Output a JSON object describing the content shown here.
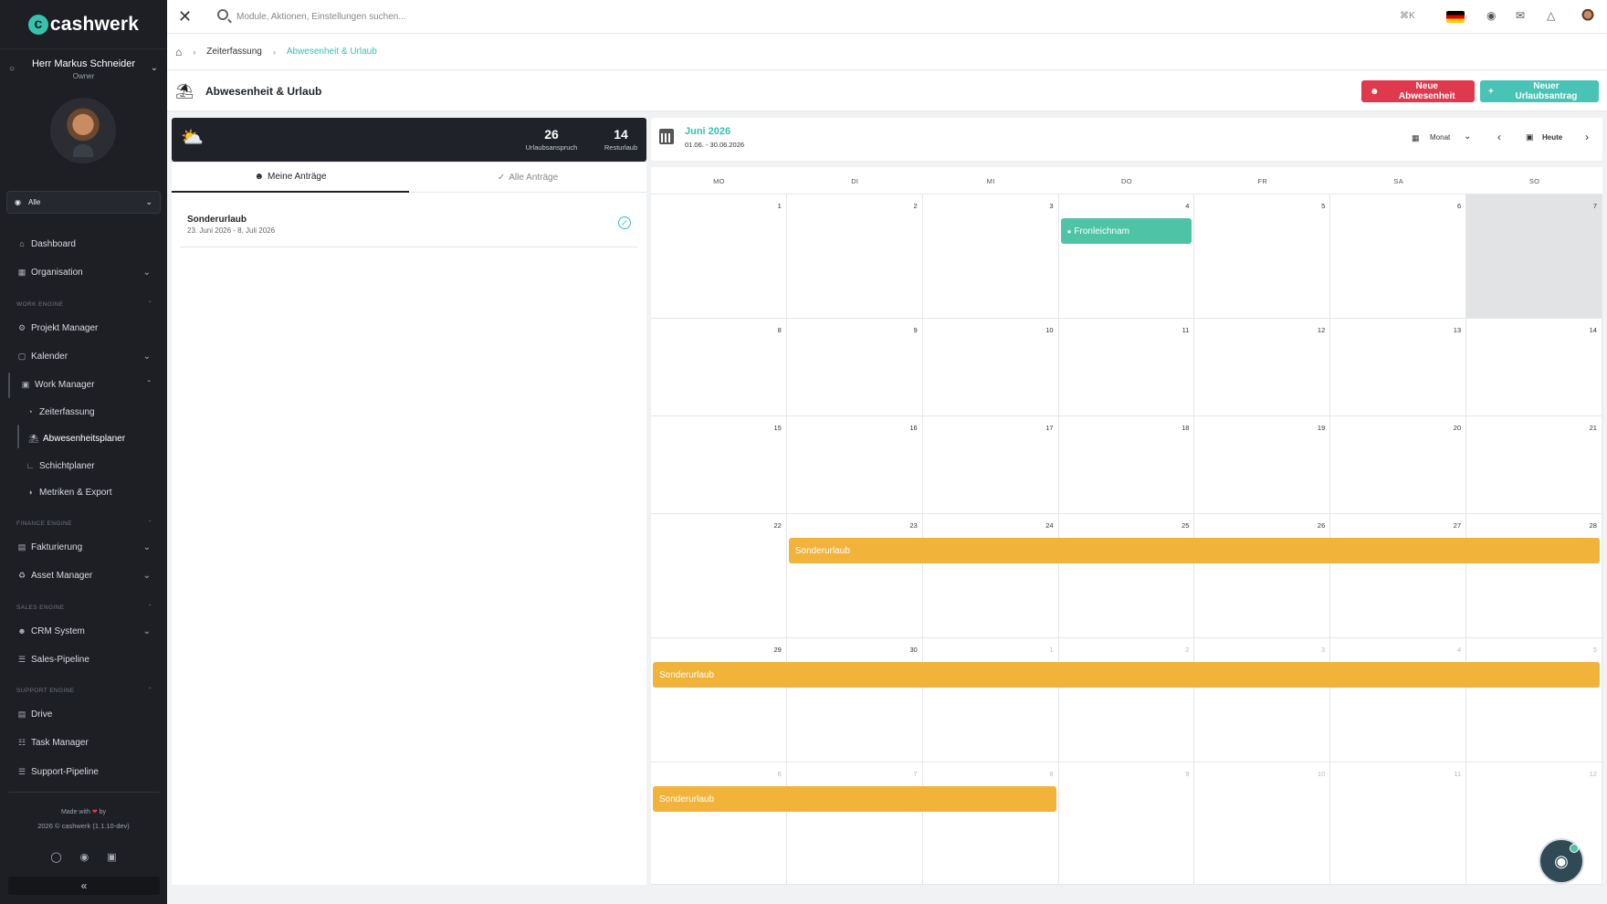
{
  "brand": {
    "logo_mark": "c",
    "name": "cashwerk",
    "accent_color": "#37c2ae"
  },
  "user": {
    "name": "Herr Markus Schneider",
    "role": "Owner"
  },
  "scope_select": {
    "value": "Alle"
  },
  "sidebar": {
    "items": [
      {
        "label": "Dashboard",
        "icon": "home-icon"
      },
      {
        "label": "Organisation",
        "icon": "building-icon"
      },
      {
        "label": "Projekt Manager",
        "icon": "diagram-icon"
      },
      {
        "label": "Kalender",
        "icon": "calendar-icon"
      },
      {
        "label": "Work Manager",
        "icon": "briefcase-icon"
      },
      {
        "label": "Zeiterfassung",
        "icon": "stopwatch-icon"
      },
      {
        "label": "Abwesenheitsplaner",
        "icon": "beach-icon"
      },
      {
        "label": "Schichtplaner",
        "icon": "chart-icon"
      },
      {
        "label": "Metriken & Export",
        "icon": "pie-icon"
      },
      {
        "label": "Fakturierung",
        "icon": "invoice-icon"
      },
      {
        "label": "Asset Manager",
        "icon": "asset-icon"
      },
      {
        "label": "CRM System",
        "icon": "users-icon"
      },
      {
        "label": "Sales-Pipeline",
        "icon": "pipeline-icon"
      },
      {
        "label": "Drive",
        "icon": "drive-icon"
      },
      {
        "label": "Task Manager",
        "icon": "tasks-icon"
      },
      {
        "label": "Support-Pipeline",
        "icon": "pipeline-icon"
      }
    ],
    "sections": [
      "WORK ENGINE",
      "FINANCE ENGINE",
      "SALES ENGINE",
      "SUPPORT ENGINE"
    ]
  },
  "footer": {
    "made_with": "Made with",
    "made_by": "by",
    "copyright": "2026 © cashwerk (1.1.10-dev)"
  },
  "search": {
    "placeholder": "Module, Aktionen, Einstellungen suchen...",
    "shortcut": "⌘K"
  },
  "breadcrumb": {
    "items": [
      "Zeiterfassung",
      "Abwesenheit & Urlaub"
    ]
  },
  "page": {
    "title": "Abwesenheit & Urlaub"
  },
  "actions": {
    "new_absence": "Neue Abwesenheit",
    "new_vacation": "Neuer Urlaubsantrag"
  },
  "stats": {
    "entitlement_value": "26",
    "entitlement_label": "Urlaubsanspruch",
    "remaining_value": "14",
    "remaining_label": "Resturlaub"
  },
  "tabs": {
    "mine": "Meine Anträge",
    "all": "Alle Anträge"
  },
  "requests": [
    {
      "title": "Sonderurlaub",
      "dates": "23. Juni 2026 - 8. Juli 2026",
      "status": "approved"
    }
  ],
  "calendar": {
    "month": "Juni 2026",
    "range": "01.06. - 30.06.2026",
    "view": "Monat",
    "today": "Heute",
    "weekdays": [
      "MO",
      "DI",
      "MI",
      "DO",
      "FR",
      "SA",
      "SO"
    ],
    "weeks": [
      [
        "1",
        "2",
        "3",
        "4",
        "5",
        "6",
        "7"
      ],
      [
        "8",
        "9",
        "10",
        "11",
        "12",
        "13",
        "14"
      ],
      [
        "15",
        "16",
        "17",
        "18",
        "19",
        "20",
        "21"
      ],
      [
        "22",
        "23",
        "24",
        "25",
        "26",
        "27",
        "28"
      ],
      [
        "29",
        "30",
        "1",
        "2",
        "3",
        "4",
        "5"
      ],
      [
        "6",
        "7",
        "8",
        "9",
        "10",
        "11",
        "12"
      ]
    ],
    "events": [
      {
        "label": "Fronleichnam",
        "type": "holiday",
        "color": "#4ec3a6"
      },
      {
        "label": "Sonderurlaub",
        "type": "leave",
        "color": "#f1b33a"
      },
      {
        "label": "Sonderurlaub",
        "type": "leave",
        "color": "#f1b33a"
      },
      {
        "label": "Sonderurlaub",
        "type": "leave",
        "color": "#f1b33a"
      }
    ]
  }
}
